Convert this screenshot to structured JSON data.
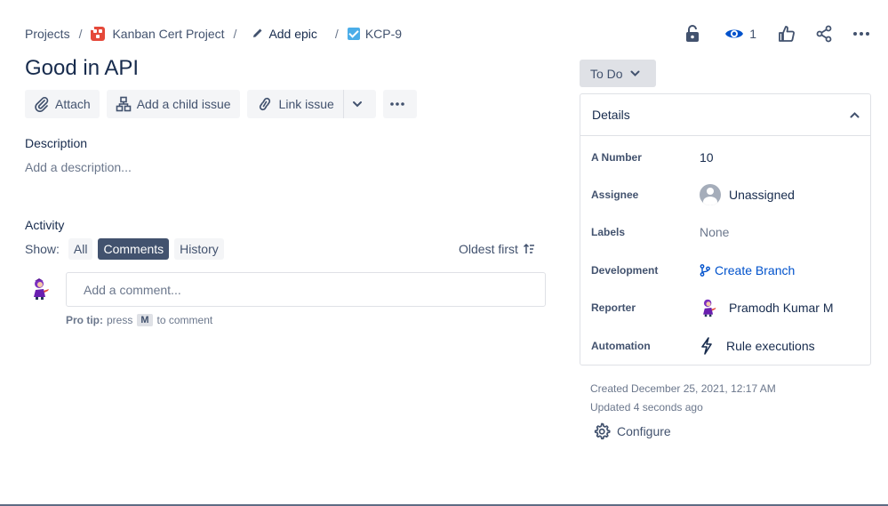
{
  "breadcrumb": {
    "projects": "Projects",
    "separator": "/",
    "project_name": "Kanban Cert Project",
    "epic_label": "Add epic",
    "issue_key": "KCP-9"
  },
  "header": {
    "watch_count": "1",
    "icons": [
      "lock-icon",
      "eye-icon",
      "thumbs-up-icon",
      "share-icon",
      "more-icon"
    ]
  },
  "issue": {
    "title": "Good in API"
  },
  "toolbar": {
    "attach": "Attach",
    "add_child": "Add a child issue",
    "link_issue": "Link issue"
  },
  "description": {
    "heading": "Description",
    "placeholder": "Add a description..."
  },
  "activity": {
    "heading": "Activity",
    "show_label": "Show:",
    "filters": [
      "All",
      "Comments",
      "History"
    ],
    "active_filter": "Comments",
    "sort_label": "Oldest first",
    "comment_placeholder": "Add a comment...",
    "protip_bold": "Pro tip:",
    "protip_press": "press",
    "protip_key": "M",
    "protip_tail": "to comment"
  },
  "status": {
    "label": "To Do"
  },
  "details": {
    "heading": "Details",
    "rows": [
      {
        "key": "A Number",
        "value": "10"
      },
      {
        "key": "Assignee",
        "value": "Unassigned"
      },
      {
        "key": "Labels",
        "value": "None"
      },
      {
        "key": "Development",
        "value": "Create Branch"
      },
      {
        "key": "Reporter",
        "value": "Pramodh Kumar M"
      },
      {
        "key": "Automation",
        "value": "Rule executions"
      }
    ]
  },
  "meta": {
    "created": "Created December 25, 2021, 12:17 AM",
    "updated": "Updated 4 seconds ago",
    "configure": "Configure"
  },
  "colors": {
    "primary_text": "#172b4d",
    "link": "#0052cc",
    "project_icon": "#e5493a",
    "task_icon": "#4bade8",
    "watch_icon": "#0052cc"
  }
}
